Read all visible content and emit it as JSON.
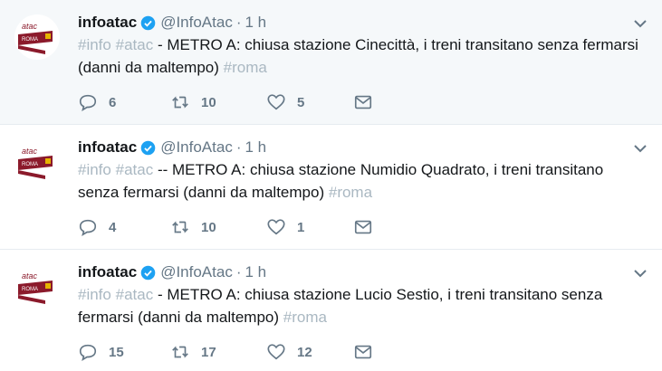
{
  "tweets": [
    {
      "name": "infoatac",
      "handle": "@InfoAtac",
      "dot": "·",
      "time": "1 h",
      "tags": [
        "#info",
        "#atac"
      ],
      "body": "- METRO A: chiusa stazione Cinecittà, i treni transitano senza fermarsi (danni da maltempo)",
      "end_tag": "#roma",
      "replies": "6",
      "retweets": "10",
      "likes": "5"
    },
    {
      "name": "infoatac",
      "handle": "@InfoAtac",
      "dot": "·",
      "time": "1 h",
      "tags": [
        "#info",
        "#atac"
      ],
      "body": "-- METRO A: chiusa stazione Numidio Quadrato, i treni transitano senza fermarsi (danni da maltempo)",
      "end_tag": "#roma",
      "replies": "4",
      "retweets": "10",
      "likes": "1"
    },
    {
      "name": "infoatac",
      "handle": "@InfoAtac",
      "dot": "·",
      "time": "1 h",
      "tags": [
        "#info",
        "#atac"
      ],
      "body": "- METRO A: chiusa stazione Lucio Sestio, i treni transitano senza fermarsi (danni da maltempo)",
      "end_tag": "#roma",
      "replies": "15",
      "retweets": "17",
      "likes": "12"
    }
  ],
  "avatar": {
    "logo_text": "atac",
    "sub_text": "ROMA",
    "brand_color": "#8b1a2b"
  },
  "colors": {
    "verified": "#1da1f2",
    "hashtag": "#aab8c2",
    "meta": "#657786"
  }
}
